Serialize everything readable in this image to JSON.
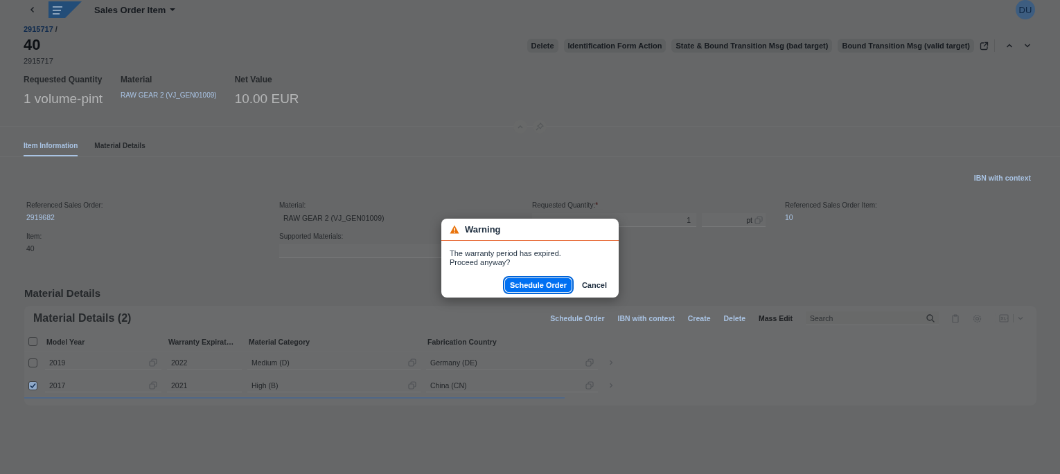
{
  "shell": {
    "title": "Sales Order Item",
    "avatar": "DU"
  },
  "header": {
    "breadcrumb": "2915717",
    "breadcrumb_sep": "/",
    "title": "40",
    "subtitle": "2915717",
    "actions": [
      "Delete",
      "Identification Form Action",
      "State & Bound Transition Msg (bad target)",
      "Bound Transition Msg (valid target)"
    ]
  },
  "kpis": [
    {
      "label": "Requested Quantity",
      "value": "1 volume-pint",
      "kind": "plain"
    },
    {
      "label": "Material",
      "value": "RAW GEAR 2 (VJ_GEN01009)",
      "kind": "link"
    },
    {
      "label": "Net Value",
      "value": "10.00 EUR",
      "kind": "plain"
    }
  ],
  "tabs": [
    {
      "label": "Item Information",
      "selected": true
    },
    {
      "label": "Material Details",
      "selected": false
    }
  ],
  "section_action": "IBN with context",
  "form": [
    {
      "label": "Referenced Sales Order:",
      "value": "2919682",
      "kind": "link"
    },
    {
      "label": "Material:",
      "value": "RAW GEAR 2 (VJ_GEN01009)",
      "kind": "display"
    },
    {
      "label": "Requested Quantity:",
      "required_mark": "*",
      "value": "1",
      "unit": "pt",
      "kind": "quantity"
    },
    {
      "label": "Referenced Sales Order Item:",
      "value": "10",
      "kind": "link"
    },
    {
      "label": "Item:",
      "value": "40",
      "kind": "text"
    },
    {
      "label": "Supported Materials:",
      "kind": "input"
    }
  ],
  "section_title": "Material Details",
  "table": {
    "title": "Material Details (2)",
    "actions": [
      {
        "label": "Schedule Order",
        "kind": "link"
      },
      {
        "label": "IBN with context",
        "kind": "link"
      },
      {
        "label": "Create",
        "kind": "link"
      },
      {
        "label": "Delete",
        "kind": "link"
      },
      {
        "label": "Mass Edit",
        "kind": "plain"
      }
    ],
    "search": {
      "placeholder": "Search"
    },
    "all_selected": false,
    "columns": [
      {
        "label": "Model Year",
        "kind": "value_help"
      },
      {
        "label": "Warranty Expirat…",
        "kind": "text"
      },
      {
        "label": "Material Category",
        "kind": "value_help"
      },
      {
        "label": "Fabrication Country",
        "kind": "value_help"
      }
    ],
    "rows": [
      {
        "selected": false,
        "cells": [
          "2019",
          "2022",
          "Medium (D)",
          "Germany (DE)"
        ]
      },
      {
        "selected": true,
        "cells": [
          "2017",
          "2021",
          "High (B)",
          "China (CN)"
        ]
      }
    ]
  },
  "dialog": {
    "title": "Warning",
    "message": "The warranty period has expired.\nProceed anyway?",
    "buttons": [
      {
        "label": "Schedule Order",
        "kind": "primary"
      },
      {
        "label": "Cancel",
        "kind": "plain"
      }
    ]
  }
}
